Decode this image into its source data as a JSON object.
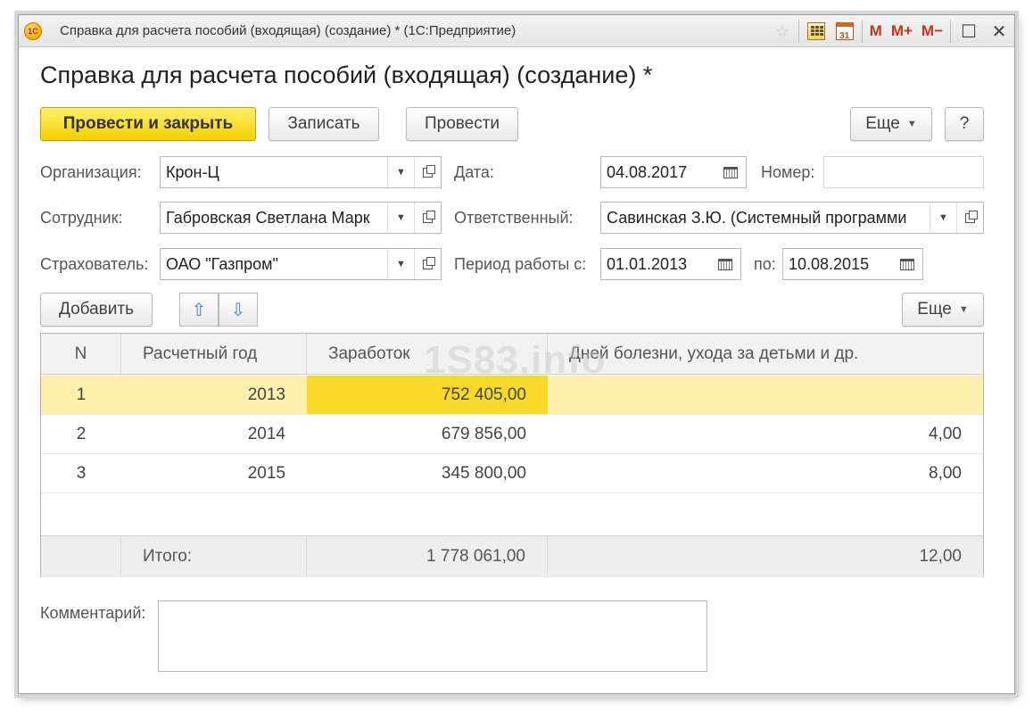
{
  "window": {
    "title": "Справка для расчета пособий (входящая) (создание) * (1С:Предприятие)",
    "icons": [
      "1c-logo-icon",
      "favorite-star-icon",
      "calculator-icon",
      "calendar-icon"
    ],
    "memory_buttons": [
      "M",
      "M+",
      "M−"
    ],
    "controls": {
      "maximize": "☐",
      "close": "✕"
    }
  },
  "page": {
    "title": "Справка для расчета пособий (входящая) (создание) *"
  },
  "toolbar": {
    "post_close": "Провести и закрыть",
    "save": "Записать",
    "post": "Провести",
    "more": "Еще",
    "help": "?"
  },
  "form": {
    "organization": {
      "label": "Организация:",
      "value": "Крон-Ц"
    },
    "employee": {
      "label": "Сотрудник:",
      "value": "Габровская Светлана Марк"
    },
    "insurer": {
      "label": "Страхователь:",
      "value": "ОАО \"Газпром\""
    },
    "date": {
      "label": "Дата:",
      "value": "04.08.2017"
    },
    "number": {
      "label": "Номер:",
      "value": ""
    },
    "responsible": {
      "label": "Ответственный:",
      "value": "Савинская З.Ю. (Системный программи"
    },
    "period": {
      "label": "Период работы с:",
      "from": "01.01.2013",
      "to_label": "по:",
      "to": "10.08.2015"
    }
  },
  "table_toolbar": {
    "add": "Добавить",
    "more": "Еще",
    "up_icon": "arrow-up-icon",
    "down_icon": "arrow-down-icon"
  },
  "table": {
    "columns": [
      "N",
      "Расчетный год",
      "Заработок",
      "Дней болезни, ухода за детьми и др."
    ],
    "rows": [
      {
        "n": "1",
        "year": "2013",
        "earnings": "752 405,00",
        "days": ""
      },
      {
        "n": "2",
        "year": "2014",
        "earnings": "679 856,00",
        "days": "4,00"
      },
      {
        "n": "3",
        "year": "2015",
        "earnings": "345 800,00",
        "days": "8,00"
      }
    ],
    "totals": {
      "label": "Итого:",
      "earnings": "1 778 061,00",
      "days": "12,00"
    }
  },
  "watermark": "1S83.info",
  "comment": {
    "label": "Комментарий:",
    "value": ""
  },
  "colors": {
    "primary_button": "#f2d000",
    "selected_row": "#fdf0ad",
    "selected_cell": "#f7d92a",
    "arrow": "#3f7fd6"
  }
}
